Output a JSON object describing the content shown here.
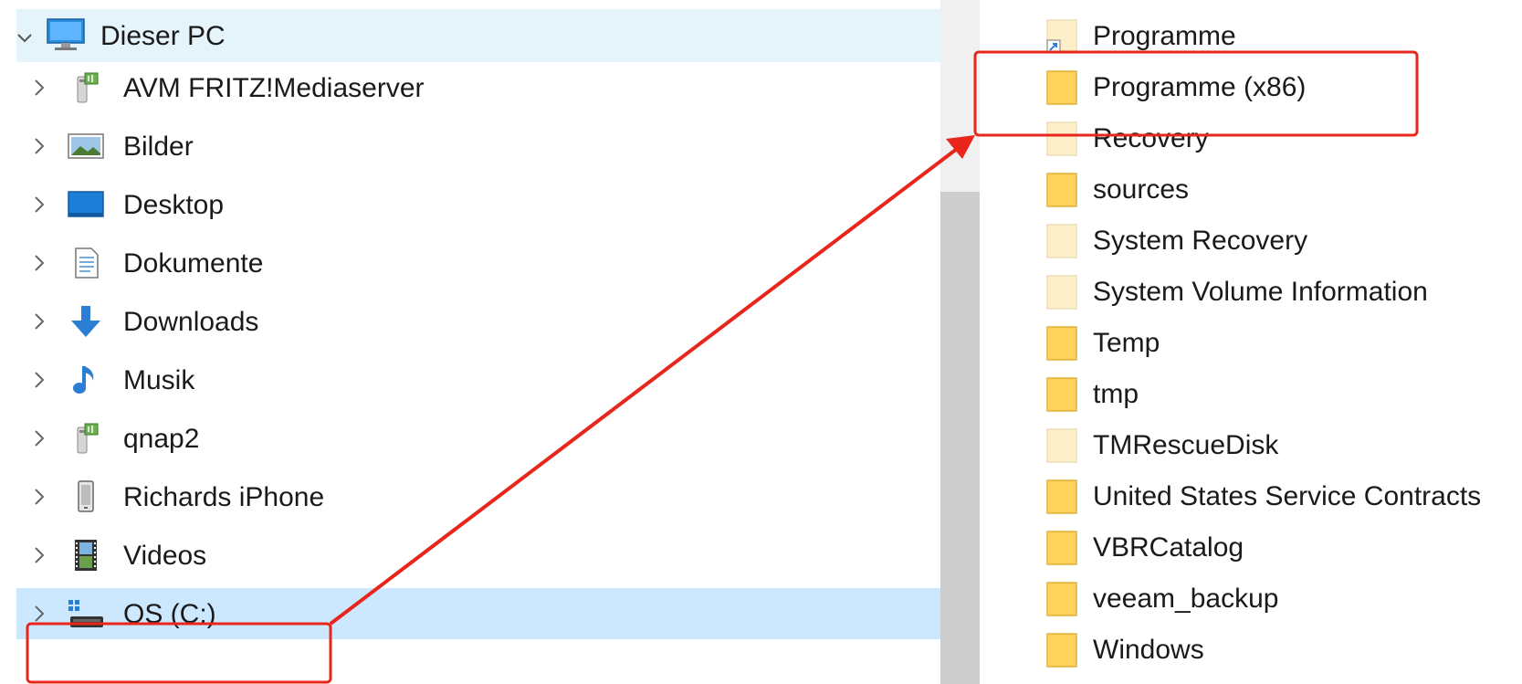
{
  "nav": {
    "root": {
      "label": "Dieser PC",
      "icon": "computer-icon"
    },
    "items": [
      {
        "label": "AVM FRITZ!Mediaserver",
        "icon": "media-server-icon"
      },
      {
        "label": "Bilder",
        "icon": "pictures-icon"
      },
      {
        "label": "Desktop",
        "icon": "desktop-icon"
      },
      {
        "label": "Dokumente",
        "icon": "documents-icon"
      },
      {
        "label": "Downloads",
        "icon": "download-arrow-icon"
      },
      {
        "label": "Musik",
        "icon": "music-note-icon"
      },
      {
        "label": "qnap2",
        "icon": "media-server-icon"
      },
      {
        "label": "Richards iPhone",
        "icon": "phone-icon"
      },
      {
        "label": "Videos",
        "icon": "film-icon"
      },
      {
        "label": "OS (C:)",
        "icon": "drive-icon",
        "selected": true
      }
    ]
  },
  "folders": [
    {
      "name": "Programme",
      "hidden": true,
      "shortcut": true
    },
    {
      "name": "Programme (x86)",
      "hidden": false
    },
    {
      "name": "Recovery",
      "hidden": true
    },
    {
      "name": "sources",
      "hidden": false
    },
    {
      "name": "System Recovery",
      "hidden": true
    },
    {
      "name": "System Volume Information",
      "hidden": true
    },
    {
      "name": "Temp",
      "hidden": false
    },
    {
      "name": "tmp",
      "hidden": false
    },
    {
      "name": "TMRescueDisk",
      "hidden": true
    },
    {
      "name": "United States Service Contracts",
      "hidden": false
    },
    {
      "name": "VBRCatalog",
      "hidden": false
    },
    {
      "name": "veeam_backup",
      "hidden": false
    },
    {
      "name": "Windows",
      "hidden": false
    }
  ],
  "colors": {
    "selection": "#cce8ff",
    "hover": "#e5f3fb",
    "folder": "#ffd35c",
    "folder_hidden": "#fdf0c8",
    "annotation": "#e8261c"
  }
}
